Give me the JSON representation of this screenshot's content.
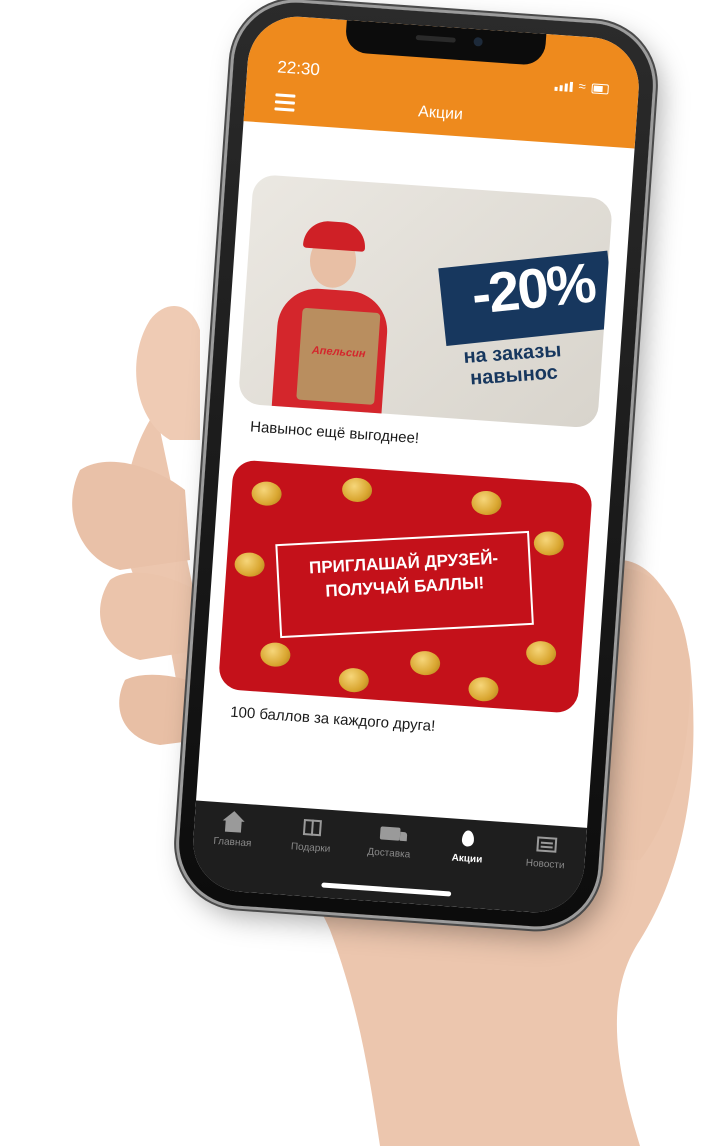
{
  "status_bar": {
    "time": "22:30"
  },
  "app_bar": {
    "title": "Акции"
  },
  "promotions": [
    {
      "image": {
        "discount": "-20%",
        "subtitle": "на заказы навынос",
        "bag_logo": "Апельсин"
      },
      "caption": "Навынос ещё выгоднее!"
    },
    {
      "image": {
        "headline": "ПРИГЛАШАЙ ДРУЗЕЙ- ПОЛУЧАЙ БАЛЛЫ!"
      },
      "caption": "100 баллов за каждого друга!"
    }
  ],
  "tab_bar": {
    "items": [
      {
        "label": "Главная",
        "icon": "home-icon"
      },
      {
        "label": "Подарки",
        "icon": "gift-icon"
      },
      {
        "label": "Доставка",
        "icon": "truck-icon"
      },
      {
        "label": "Акции",
        "icon": "fire-icon"
      },
      {
        "label": "Новости",
        "icon": "news-icon"
      }
    ],
    "active_label": "Акции"
  },
  "colors": {
    "app_bar": "#ee8a1d",
    "tab_bar": "#1e1e1e",
    "banner_red": "#c4111a",
    "banner_navy": "#17375e"
  }
}
